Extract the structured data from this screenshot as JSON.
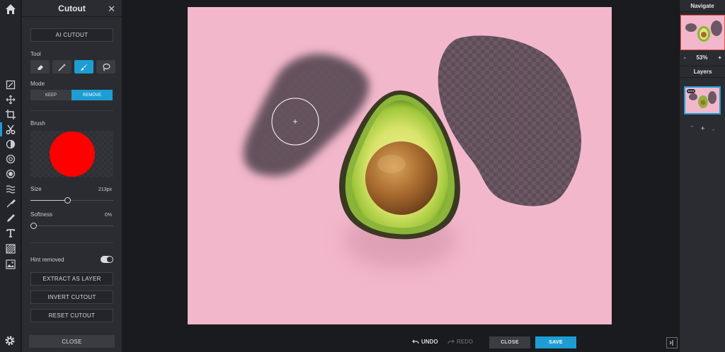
{
  "panel": {
    "title": "Cutout",
    "close_glyph": "✕",
    "ai_cutout": "AI CUTOUT",
    "tool_label": "Tool",
    "tools": [
      "eraser-tool",
      "magic-wand-tool",
      "brush-tool",
      "lasso-tool"
    ],
    "active_tool": "brush-tool",
    "mode_label": "Mode",
    "mode_keep": "KEEP",
    "mode_remove": "REMOVE",
    "brush_label": "Brush",
    "brush_color": "#ff0000",
    "size_label": "Size",
    "size_value": "213px",
    "size_fraction": 0.44,
    "softness_label": "Softness",
    "softness_value": "0%",
    "softness_fraction": 0.0,
    "hint_label": "Hint removed",
    "hint_on": true,
    "extract": "EXTRACT AS LAYER",
    "invert": "INVERT CUTOUT",
    "reset": "RESET CUTOUT",
    "close": "CLOSE"
  },
  "bottom": {
    "undo": "UNDO",
    "redo": "REDO",
    "close": "CLOSE",
    "save": "SAVE"
  },
  "right": {
    "navigate": "Navigate",
    "zoom_minus": "-",
    "zoom_value": "53%",
    "zoom_plus": "+",
    "layers": "Layers",
    "up": "^",
    "add": "+",
    "down": "v"
  },
  "colors": {
    "accent": "#1e9dd4",
    "background": "#f3b7cb",
    "remove_mask": "#5a4a55"
  }
}
